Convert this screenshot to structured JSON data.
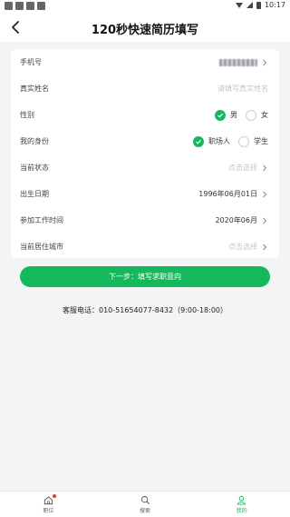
{
  "status_bar": {
    "time": "10:17"
  },
  "header": {
    "title": "120秒快速简历填写"
  },
  "form": {
    "phone": {
      "label": "手机号"
    },
    "name": {
      "label": "真实姓名",
      "placeholder": "请填写真实姓名"
    },
    "gender": {
      "label": "性别",
      "options": [
        "男",
        "女"
      ],
      "selected": "男"
    },
    "identity": {
      "label": "我的身份",
      "options": [
        "职场人",
        "学生"
      ],
      "selected": "职场人"
    },
    "status": {
      "label": "当前状态",
      "placeholder": "点击选择"
    },
    "birth": {
      "label": "出生日期",
      "value": "1996年06月01日"
    },
    "work_start": {
      "label": "参加工作时间",
      "value": "2020年06月"
    },
    "city": {
      "label": "当前居住城市",
      "placeholder": "点击选择"
    }
  },
  "next_button": {
    "label": "下一步：填写求职意向"
  },
  "service": {
    "text": "客服电话：010-51654077-8432（9:00-18:00）"
  },
  "bottom_nav": {
    "items": [
      {
        "label": "职位",
        "icon": "home-icon"
      },
      {
        "label": "搜索",
        "icon": "search-icon"
      },
      {
        "label": "我的",
        "icon": "user-icon"
      }
    ],
    "active": "我的",
    "accent": "#17b85c"
  }
}
